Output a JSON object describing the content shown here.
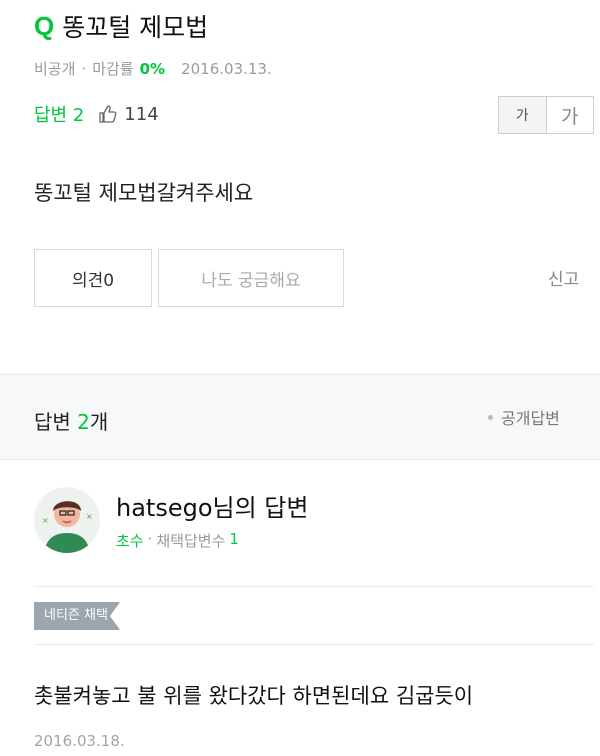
{
  "question": {
    "mark": "Q",
    "title": "똥꼬털 제모법",
    "visibility": "비공개",
    "closing_rate_label": "마감률",
    "closing_rate_value": "0%",
    "date": "2016.03.13.",
    "answer_label": "답변 2",
    "thumb_icon": "thumb-up-icon",
    "likes": "114",
    "body": "똥꼬털 제모법갈켜주세요"
  },
  "font_size_toggle": {
    "small": "가",
    "large": "가"
  },
  "actions": {
    "opinion": "의견0",
    "curious": "나도 궁금해요",
    "report": "신고"
  },
  "answers_section": {
    "label": "답변",
    "count": "2",
    "suffix": "개",
    "public_answer": "공개답변"
  },
  "answer": {
    "username": "hatsego님의 답변",
    "rank": "초수",
    "sep": "·",
    "adopted_label": "채택답변수",
    "adopted_count": "1",
    "badge": "네티즌 채택",
    "text": "촛불켜놓고 불 위를 왔다갔다 하면된데요 김굽듯이",
    "date": "2016.03.18."
  },
  "colors": {
    "accent": "#00c73c",
    "muted": "#9a9a9a",
    "section_bg": "#f7f8f9",
    "badge_bg": "#9aa7b0"
  }
}
